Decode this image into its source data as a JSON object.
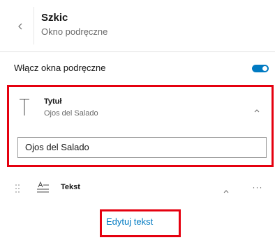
{
  "header": {
    "title": "Szkic",
    "subtitle": "Okno podręczne",
    "back_icon": "chevron-left-icon"
  },
  "toggle_row": {
    "label": "Włącz okna podręczne",
    "enabled": true,
    "accent_color": "#007ac2"
  },
  "title_block": {
    "label": "Tytuł",
    "value_preview": "Ojos del Salado",
    "input_value": "Ojos del Salado",
    "icon": "title-text-icon",
    "expanded": true
  },
  "text_block": {
    "label": "Tekst",
    "icon": "text-align-icon",
    "more_glyph": "···"
  },
  "edit_button": {
    "label": "Edytuj tekst"
  },
  "highlight_color": "#e5000f"
}
